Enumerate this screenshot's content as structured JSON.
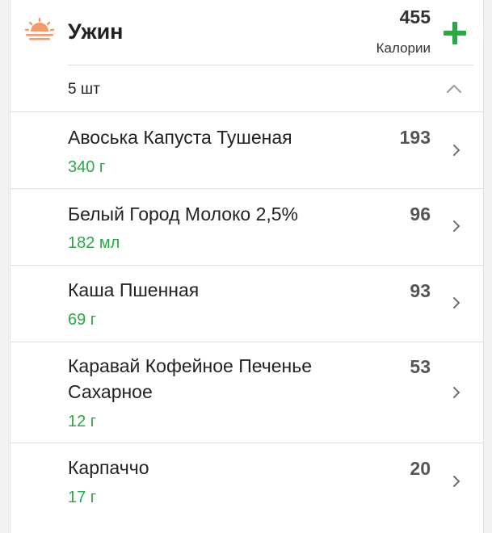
{
  "meal": {
    "title": "Ужин",
    "icon": "sunset-icon",
    "total_calories": "455",
    "calories_label": "Калории",
    "add_icon": "plus-icon",
    "accent_color": "#2aa845",
    "icon_color": "#f29a6b"
  },
  "summary": {
    "count_text": "5 шт",
    "collapse_icon": "chevron-up-icon"
  },
  "items": [
    {
      "name": "Авоська Капуста Тушеная",
      "amount": "340 г",
      "calories": "193"
    },
    {
      "name": "Белый Город Молоко 2,5%",
      "amount": "182 мл",
      "calories": "96"
    },
    {
      "name": "Каша Пшенная",
      "amount": "69 г",
      "calories": "93"
    },
    {
      "name": "Каравай Кофейное Печенье Сахарное",
      "amount": "12 г",
      "calories": "53"
    },
    {
      "name": "Карпаччо",
      "amount": "17 г",
      "calories": "20"
    }
  ]
}
